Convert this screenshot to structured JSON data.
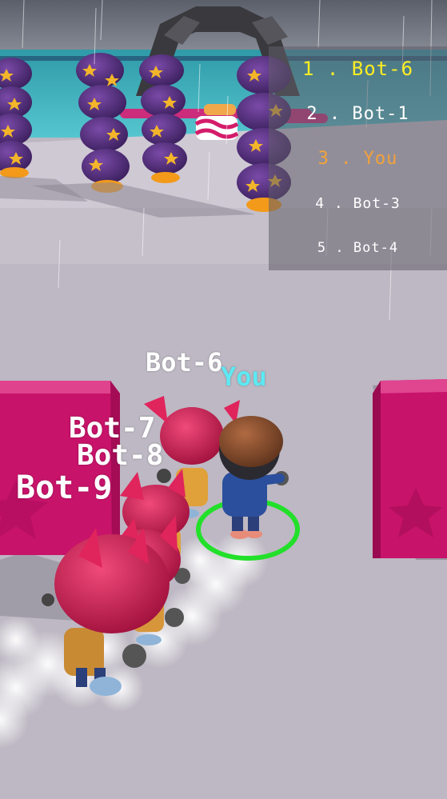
{
  "leaderboard": {
    "rows": [
      {
        "rank": "1",
        "sep": " . ",
        "name": "Bot-6",
        "color": "#ffee22"
      },
      {
        "rank": "2",
        "sep": " . ",
        "name": "Bot-1",
        "color": "#ffffff"
      },
      {
        "rank": "3",
        "sep": " . ",
        "name": "You",
        "color": "#f2a23a"
      },
      {
        "rank": "4",
        "sep": " . ",
        "name": "Bot-3",
        "color": "#ffffff"
      },
      {
        "rank": "5",
        "sep": " . ",
        "name": "Bot-4",
        "color": "#ffffff"
      }
    ]
  },
  "name_tags": {
    "bot6": "Bot-6",
    "you": "You",
    "bot7": "Bot-7",
    "bot8": "Bot-8",
    "bot9": "Bot-9"
  },
  "colors": {
    "player_tag": "#5ee8f2",
    "bot_tag": "#ffffff",
    "leader_highlight": "#ffee22",
    "player_highlight": "#f2a23a",
    "wall_magenta": "#c8136a",
    "ring_green": "#22e02a",
    "water": "#3fb6c0"
  }
}
